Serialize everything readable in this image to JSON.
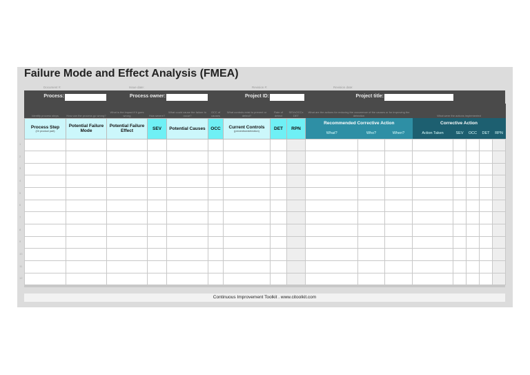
{
  "title": "Failure Mode and Effect Analysis (FMEA)",
  "meta": {
    "document": "Document #:",
    "issue_date": "Issue date:",
    "revision": "Revision #:",
    "revision_date": "Revision date:"
  },
  "fields": {
    "process": "Process:",
    "process_owner": "Process owner:",
    "project_id": "Project ID:",
    "project_title": "Project title:"
  },
  "hints": [
    "Identify process steps",
    "How can the process go wrong?",
    "What is the impact if it goes wrong",
    "How severe?",
    "What could cause the failure to occur?",
    "OCC of causes",
    "What controls exist to prevent or detect?",
    "Rate of detect",
    "SEVxOCCx DET",
    "What are the actions for reducing the occurrence of the causes or for improving the detection",
    "What were the actions implemented"
  ],
  "columns": {
    "process_step": "Process Step",
    "process_step_sub": "(Or product part)",
    "failure_mode": "Potential Failure Mode",
    "failure_effect": "Potential Failure Effect",
    "sev": "SEV",
    "causes": "Potential Causes",
    "occ": "OCC",
    "controls": "Current Controls",
    "controls_sub": "(prevention/detection)",
    "det": "DET",
    "rpn": "RPN"
  },
  "recommended": {
    "title": "Recommended Corrective Action",
    "what": "What?",
    "who": "Who?",
    "when": "When?"
  },
  "corrective": {
    "title": "Corrective Action",
    "action_taken": "Action Taken",
    "sev": "SEV",
    "occ": "OCC",
    "det": "DET",
    "rpn": "RPN"
  },
  "row_numbers": [
    "1",
    "2",
    "3",
    "4",
    "5",
    "6",
    "7",
    "8",
    "9",
    "10",
    "11",
    "12"
  ],
  "footer": "Continuous Improvement Toolkit . www.citoolkit.com"
}
